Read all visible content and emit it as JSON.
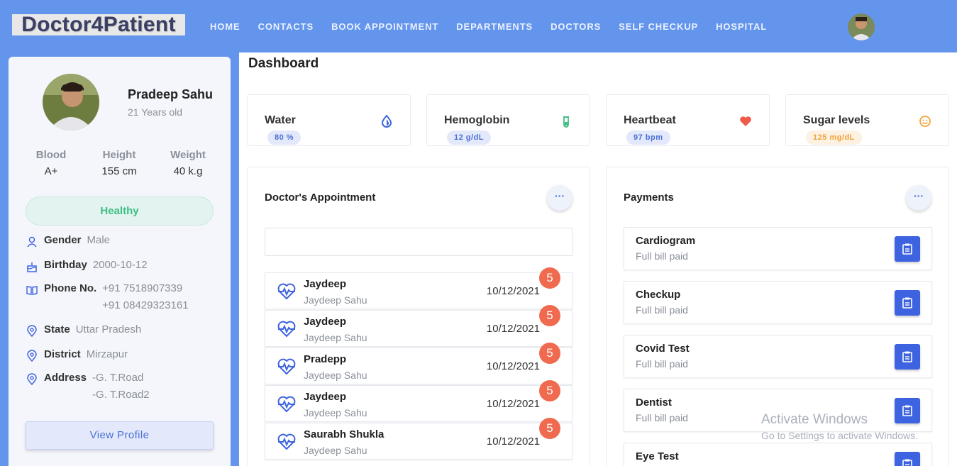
{
  "nav": {
    "logo": "Doctor4Patient",
    "links": [
      "HOME",
      "CONTACTS",
      "BOOK APPOINTMENT",
      "DEPARTMENTS",
      "DOCTORS",
      "SELF CHECKUP",
      "HOSPITAL"
    ]
  },
  "profile": {
    "name": "Pradeep Sahu",
    "age": "21 Years old",
    "stats": [
      {
        "label": "Blood",
        "value": "A+"
      },
      {
        "label": "Height",
        "value": "155 cm"
      },
      {
        "label": "Weight",
        "value": "40 k.g"
      }
    ],
    "status": "Healthy",
    "gender_label": "Gender",
    "gender": "Male",
    "birthday_label": "Birthday",
    "birthday": "2000-10-12",
    "phone_label": "Phone No.",
    "phone1": "+91 7518907339",
    "phone2": "+91 08429323161",
    "state_label": "State",
    "state": "Uttar Pradesh",
    "district_label": "District",
    "district": "Mirzapur",
    "address_label": "Address",
    "address1": "-G. T.Road",
    "address2": "-G. T.Road2",
    "view_profile": "View Profile"
  },
  "dashboard": {
    "title": "Dashboard",
    "metrics": [
      {
        "name": "Water",
        "value": "80 %",
        "icon": "droplet-icon",
        "color": "#3d63e0",
        "badge_bg": "#e3e9fb",
        "badge_fg": "#4a6fd6"
      },
      {
        "name": "Hemoglobin",
        "value": "12 g/dL",
        "icon": "test-tube-icon",
        "color": "#3cbf84",
        "badge_bg": "#e3e9fb",
        "badge_fg": "#4a6fd6"
      },
      {
        "name": "Heartbeat",
        "value": "97 bpm",
        "icon": "heart-icon",
        "color": "#ef5a4a",
        "badge_bg": "#e3e9fb",
        "badge_fg": "#4a6fd6"
      },
      {
        "name": "Sugar levels",
        "value": "125 mg/dL",
        "icon": "smile-icon",
        "color": "#f2a33a",
        "badge_bg": "#fdf1e2",
        "badge_fg": "#f2a33a"
      }
    ]
  },
  "appointments": {
    "title": "Doctor's Appointment",
    "search_placeholder": "",
    "items": [
      {
        "name": "Jaydeep",
        "sub": "Jaydeep Sahu",
        "date": "10/12/2021",
        "count": "5"
      },
      {
        "name": "Jaydeep",
        "sub": "Jaydeep Sahu",
        "date": "10/12/2021",
        "count": "5"
      },
      {
        "name": "Pradepp",
        "sub": "Jaydeep Sahu",
        "date": "10/12/2021",
        "count": "5"
      },
      {
        "name": "Jaydeep",
        "sub": "Jaydeep Sahu",
        "date": "10/12/2021",
        "count": "5"
      },
      {
        "name": "Saurabh Shukla",
        "sub": "Jaydeep Sahu",
        "date": "10/12/2021",
        "count": "5"
      }
    ]
  },
  "payments": {
    "title": "Payments",
    "items": [
      {
        "name": "Cardiogram",
        "status": "Full bill paid"
      },
      {
        "name": "Checkup",
        "status": "Full bill paid"
      },
      {
        "name": "Covid Test",
        "status": "Full bill paid"
      },
      {
        "name": "Dentist",
        "status": "Full bill paid"
      },
      {
        "name": "Eye Test",
        "status": ""
      }
    ]
  },
  "watermark": {
    "line1": "Activate Windows",
    "line2": "Go to Settings to activate Windows."
  },
  "colors": {
    "nav": "#6495ed",
    "accent": "#3d63e0",
    "badge": "#ef6a4e",
    "healthy": "#3cbf84"
  }
}
